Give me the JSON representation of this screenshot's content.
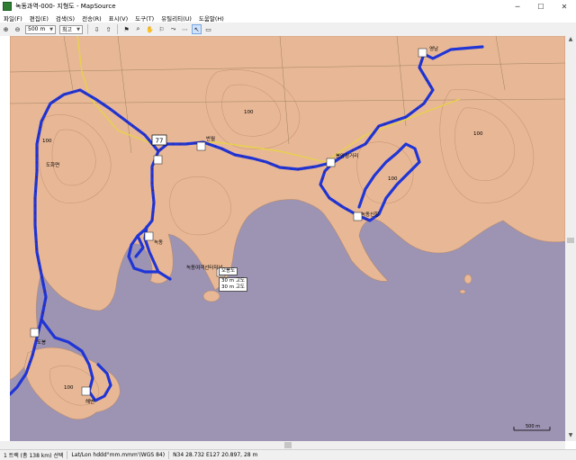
{
  "window": {
    "title": "녹동과역-000- 지형도 - MapSource",
    "minimize": "─",
    "maximize": "☐",
    "close": "✕"
  },
  "menu": [
    "파일(F)",
    "편집(E)",
    "검색(S)",
    "전송(R)",
    "표시(V)",
    "도구(T)",
    "유틸리티(U)",
    "도움말(H)"
  ],
  "toolbar": {
    "zoom_value": "500 m",
    "detail_value": "최고"
  },
  "map": {
    "route_number": "77",
    "contours": [
      "100",
      "100",
      "100",
      "100",
      "100"
    ],
    "labels": [
      "도화면",
      "오봉도",
      "30 m 고도",
      "30 m 고도",
      "녹동",
      "반월"
    ],
    "waypoint_labels": [
      "도봉",
      "녹동신항",
      "봉암삼거리",
      "영남",
      "녹동여객선터미널",
      "해변"
    ],
    "popup_title": "오봉도",
    "popup_line1": "30 m 고도",
    "popup_line2": "30 m 고도",
    "scale_label": "500 m"
  },
  "status": {
    "selection": "1 트랙 (총 138 km) 선택",
    "format": "Lat/Lon hddd°mm.mmm'(WGS 84)",
    "coords": "N34 28.732 E127 20.897, 28 m"
  },
  "colors": {
    "sea": "#9d93b2",
    "land": "#e8b896",
    "track": "#1f35d6"
  }
}
